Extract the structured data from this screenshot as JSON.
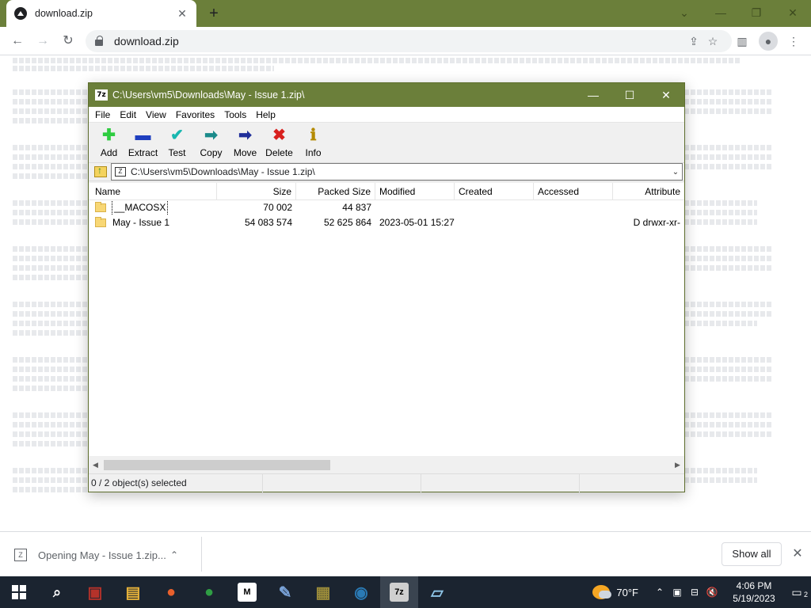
{
  "browser": {
    "tab_title": "download.zip",
    "tab_close": "✕",
    "new_tab": "+",
    "url": "download.zip",
    "window_controls": {
      "minimize": "—",
      "restore": "❐",
      "close": "✕",
      "chevron": "⌄"
    }
  },
  "zip_window": {
    "title": "C:\\Users\\vm5\\Downloads\\May - Issue 1.zip\\",
    "title_icon": "7z",
    "minimize": "—",
    "maximize": "☐",
    "close": "✕",
    "menu": [
      "File",
      "Edit",
      "View",
      "Favorites",
      "Tools",
      "Help"
    ],
    "tools": [
      {
        "label": "Add",
        "icon": "add-icon",
        "glyph": "✚",
        "color": "#2ecc40"
      },
      {
        "label": "Extract",
        "icon": "extract-icon",
        "glyph": "▬",
        "color": "#1f3fbf"
      },
      {
        "label": "Test",
        "icon": "test-icon",
        "glyph": "✔",
        "color": "#18b7b0"
      },
      {
        "label": "Copy",
        "icon": "copy-icon",
        "glyph": "➡",
        "color": "#1a8a8a"
      },
      {
        "label": "Move",
        "icon": "move-icon",
        "glyph": "➡",
        "color": "#1f2e9a"
      },
      {
        "label": "Delete",
        "icon": "delete-icon",
        "glyph": "✖",
        "color": "#d8201e"
      },
      {
        "label": "Info",
        "icon": "info-icon",
        "glyph": "ℹ",
        "color": "#b48a00"
      }
    ],
    "address": "C:\\Users\\vm5\\Downloads\\May - Issue 1.zip\\",
    "address_icon": "Z",
    "columns": [
      "Name",
      "Size",
      "Packed Size",
      "Modified",
      "Created",
      "Accessed",
      "Attribute"
    ],
    "rows": [
      {
        "name": "__MACOSX",
        "size": "70 002",
        "packed": "44 837",
        "modified": "",
        "created": "",
        "accessed": "",
        "attr": ""
      },
      {
        "name": "May - Issue 1",
        "size": "54 083 574",
        "packed": "52 625 864",
        "modified": "2023-05-01 15:27",
        "created": "",
        "accessed": "",
        "attr": "D drwxr-xr-"
      }
    ],
    "status": "0 / 2 object(s) selected"
  },
  "download_bar": {
    "item": "Opening May - Issue 1.zip...",
    "item_icon": "Z",
    "show_all": "Show all",
    "close": "✕"
  },
  "taskbar": {
    "weather": "70°F",
    "time": "4:06 PM",
    "date": "5/19/2023",
    "notifications": "2",
    "apps": [
      {
        "name": "search-app",
        "glyph": "⌕",
        "color": "transparent"
      },
      {
        "name": "winrar-app",
        "glyph": "▣",
        "color": "#b5322a"
      },
      {
        "name": "file-explorer-app",
        "glyph": "▤",
        "color": "#e8b33a"
      },
      {
        "name": "firefox-app",
        "glyph": "●",
        "color": "#e8602c"
      },
      {
        "name": "chrome-app",
        "glyph": "●",
        "color": "#2f9e44"
      },
      {
        "name": "m-app",
        "glyph": "M",
        "color": "#ffffff"
      },
      {
        "name": "editor-app",
        "glyph": "✎",
        "color": "#7aa3d8"
      },
      {
        "name": "package-app",
        "glyph": "▦",
        "color": "#9a8b3a"
      },
      {
        "name": "network-app",
        "glyph": "◉",
        "color": "#2a7ab5"
      },
      {
        "name": "7zip-app",
        "glyph": "7z",
        "color": "#cfcfcf"
      },
      {
        "name": "notepad-app",
        "glyph": "▱",
        "color": "#8fc6e8"
      }
    ]
  }
}
